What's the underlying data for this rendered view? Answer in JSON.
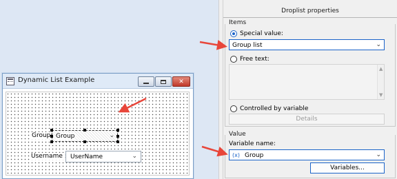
{
  "designer": {
    "window_title": "Dynamic List Example",
    "window_buttons": {
      "minimize": "minimize",
      "maximize": "maximize",
      "close": "✕"
    },
    "group_label": "Group:",
    "group_value": "Group",
    "username_label": "Username :",
    "username_value": "UserName"
  },
  "properties": {
    "title": "Droplist properties",
    "items_section": "Items",
    "special_value_label": "Special value:",
    "special_value": "Group list",
    "special_value_selected": true,
    "free_text_label": "Free text:",
    "controlled_label": "Controlled by variable",
    "details_button": "Details",
    "value_section": "Value",
    "variable_name_label": "Variable name:",
    "variable_icon": "(x)",
    "variable_value": "Group",
    "variables_button": "Variables..."
  },
  "icons": {
    "dropdown": "chevron-down-icon",
    "app": "form-icon",
    "variable": "variable-icon",
    "annotation": "arrow-icon"
  },
  "colors": {
    "accent": "#1a63c9",
    "annotation_arrow": "#e8463a",
    "canvas_bg": "#dde7f4"
  }
}
